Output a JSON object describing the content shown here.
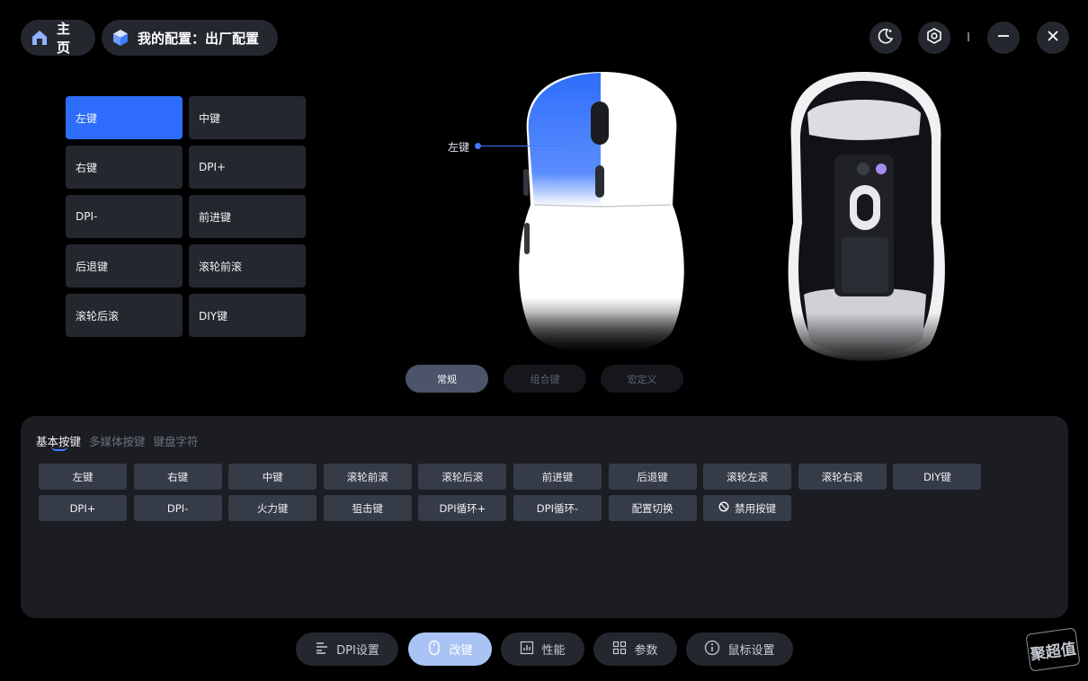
{
  "topbar": {
    "home_label": "主页",
    "config_label": "我的配置：出厂配置",
    "icons": [
      "home-icon",
      "cube-icon",
      "moon-icon",
      "gear-icon",
      "minimize-icon",
      "close-icon"
    ]
  },
  "keys": [
    "左键",
    "中键",
    "右键",
    "DPI+",
    "DPI-",
    "前进键",
    "后退键",
    "滚轮前滚",
    "滚轮后滚",
    "DIY键"
  ],
  "active_key": "左键",
  "callout_label": "左键",
  "mode_tabs": [
    "常规",
    "组合键",
    "宏定义"
  ],
  "categories": [
    "基本按键",
    "多媒体按键",
    "键盘字符"
  ],
  "functions": [
    "左键",
    "右键",
    "中键",
    "滚轮前滚",
    "滚轮后滚",
    "前进键",
    "后退键",
    "滚轮左滚",
    "滚轮右滚",
    "DIY键",
    "DPI+",
    "DPI-",
    "火力键",
    "狙击键",
    "DPI循环+",
    "DPI循环-",
    "配置切换",
    "禁用按键"
  ],
  "nav": [
    "DPI设置",
    "改键",
    "性能",
    "参数",
    "鼠标设置"
  ],
  "watermark": "聚超值",
  "colors": {
    "accent": "#2e6dfb",
    "panel": "#1b1d23",
    "nav_active": "#a9c3f5"
  }
}
